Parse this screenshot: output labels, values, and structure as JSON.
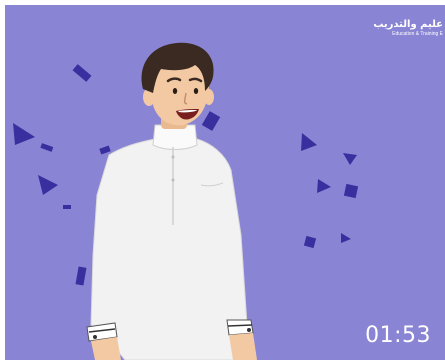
{
  "logo": {
    "arabic_text": "عليم والتدريب",
    "english_text": "Education & Training E"
  },
  "player": {
    "timestamp": "01:53"
  },
  "colors": {
    "background": "#8a84d4",
    "confetti": "#3a2f9e",
    "thobe": "#f2f2f2",
    "skin": "#f3c9a4",
    "hair": "#3b2a22"
  }
}
